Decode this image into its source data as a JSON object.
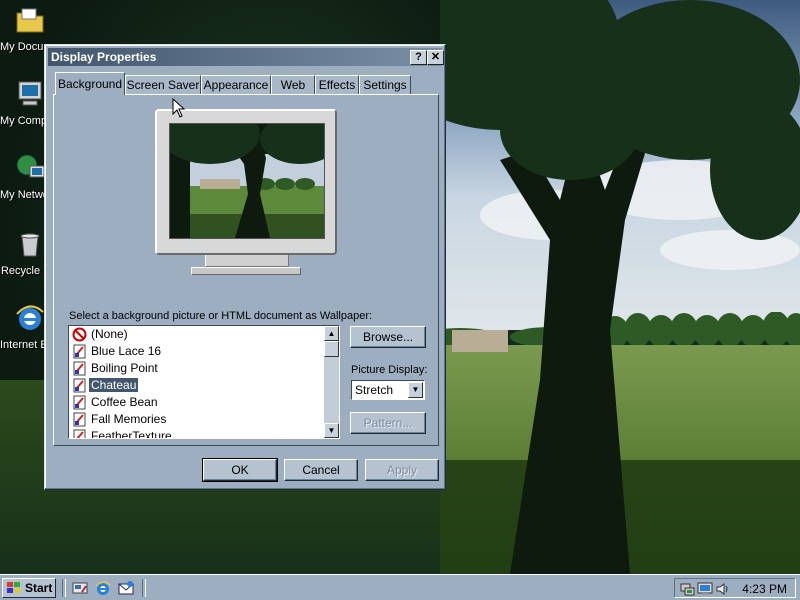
{
  "desktop": {
    "icons": [
      {
        "label": "My Documents",
        "icon": "folder-documents-icon"
      },
      {
        "label": "My Computer",
        "icon": "computer-icon"
      },
      {
        "label": "My Network Places",
        "icon": "network-icon"
      },
      {
        "label": "Recycle Bin",
        "icon": "recycle-bin-icon"
      },
      {
        "label": "Internet Explorer",
        "icon": "internet-explorer-icon"
      }
    ]
  },
  "window": {
    "title": "Display Properties",
    "help_button": "?",
    "close_button": "✕",
    "tabs": [
      {
        "label": "Background",
        "active": true
      },
      {
        "label": "Screen Saver",
        "active": false
      },
      {
        "label": "Appearance",
        "active": false
      },
      {
        "label": "Web",
        "active": false
      },
      {
        "label": "Effects",
        "active": false
      },
      {
        "label": "Settings",
        "active": false
      }
    ],
    "wallpaper_prompt": "Select a background picture or HTML document as Wallpaper:",
    "wallpapers": [
      {
        "label": "(None)",
        "icon": "none-icon",
        "selected": false
      },
      {
        "label": "Blue Lace 16",
        "icon": "bitmap-icon",
        "selected": false
      },
      {
        "label": "Boiling Point",
        "icon": "bitmap-icon",
        "selected": false
      },
      {
        "label": "Chateau",
        "icon": "bitmap-icon",
        "selected": true
      },
      {
        "label": "Coffee Bean",
        "icon": "bitmap-icon",
        "selected": false
      },
      {
        "label": "Fall Memories",
        "icon": "bitmap-icon",
        "selected": false
      },
      {
        "label": "FeatherTexture",
        "icon": "bitmap-icon",
        "selected": false
      }
    ],
    "browse_label": "Browse...",
    "picture_display_label": "Picture Display:",
    "picture_display_value": "Stretch",
    "pattern_label": "Pattern...",
    "ok_label": "OK",
    "cancel_label": "Cancel",
    "apply_label": "Apply"
  },
  "taskbar": {
    "start_label": "Start",
    "clock": "4:23 PM",
    "quick_launch": [
      "show-desktop-icon",
      "internet-explorer-icon",
      "outlook-express-icon"
    ],
    "tray": [
      "network-tray-icon",
      "display-tray-icon",
      "volume-icon"
    ]
  },
  "colors": {
    "window_face": "#9daec1",
    "title_start": "#42576d",
    "title_end": "#7a8fa6",
    "selection": "#42576d"
  }
}
